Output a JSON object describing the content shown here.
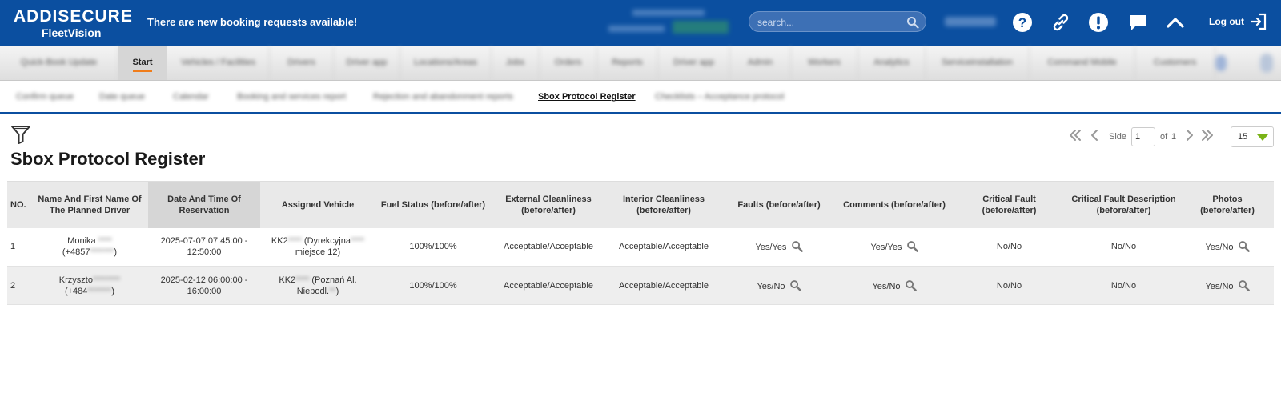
{
  "header": {
    "logo_top": "ADDISECURE",
    "logo_sub": "FleetVision",
    "notice": "There are new booking requests available!",
    "search_placeholder": "search...",
    "logout_label": "Log out"
  },
  "main_tabs": [
    {
      "label": "Quick-Book Update"
    },
    {
      "label": "Start"
    },
    {
      "label": "Vehicles / Facilities"
    },
    {
      "label": "Drivers"
    },
    {
      "label": "Driver app"
    },
    {
      "label": "Locations/Areas"
    },
    {
      "label": "Jobs"
    },
    {
      "label": "Orders"
    },
    {
      "label": "Reports"
    },
    {
      "label": "Driver app"
    },
    {
      "label": "Admin"
    },
    {
      "label": "Workers"
    },
    {
      "label": "Analytics"
    },
    {
      "label": "Serviceinstallation"
    },
    {
      "label": "Command Mobile"
    },
    {
      "label": "Customers"
    }
  ],
  "sub_tabs": [
    {
      "label": "Confirm queue"
    },
    {
      "label": "Date queue"
    },
    {
      "label": "Calendar"
    },
    {
      "label": "Booking and services report"
    },
    {
      "label": "Rejection and abandonment reports"
    },
    {
      "label": "Sbox Protocol Register"
    },
    {
      "label": "Checklists – Acceptance protocol"
    }
  ],
  "page": {
    "title": "Sbox Protocol Register"
  },
  "pagination": {
    "side_label": "Side",
    "current_page": "1",
    "of_label": "of",
    "total_pages": "1",
    "per_page": "15"
  },
  "table": {
    "columns": [
      "NO.",
      "Name And First Name Of The Planned Driver",
      "Date And Time Of Reservation",
      "Assigned Vehicle",
      "Fuel Status (before/after)",
      "External Cleanliness (before/after)",
      "Interior Cleanliness (before/after)",
      "Faults (before/after)",
      "Comments (before/after)",
      "Critical Fault (before/after)",
      "Critical Fault Description (before/after)",
      "Photos (before/after)"
    ],
    "rows": [
      {
        "no": "1",
        "driver_name": "Monika",
        "driver_phone": "(+4857",
        "date_from": "2025-07-07 07:45:00 -",
        "date_to": "12:50:00",
        "vehicle_reg": "KK2",
        "vehicle_loc1": "Dyrekcyjna",
        "vehicle_loc2": "miejsce 12)",
        "fuel": "100%/100%",
        "external": "Acceptable/Acceptable",
        "interior": "Acceptable/Acceptable",
        "faults": "Yes/Yes",
        "comments": "Yes/Yes",
        "critical": "No/No",
        "critical_desc": "No/No",
        "photos": "Yes/No"
      },
      {
        "no": "2",
        "driver_name": "Krzyszto",
        "driver_phone": "(+484",
        "date_from": "2025-02-12 06:00:00 -",
        "date_to": "16:00:00",
        "vehicle_reg": "KK2",
        "vehicle_loc1": "(Poznań Al.",
        "vehicle_loc2": "Niepodl.",
        "fuel": "100%/100%",
        "external": "Acceptable/Acceptable",
        "interior": "Acceptable/Acceptable",
        "faults": "Yes/No",
        "comments": "Yes/No",
        "critical": "No/No",
        "critical_desc": "No/No",
        "photos": "Yes/No"
      }
    ]
  }
}
